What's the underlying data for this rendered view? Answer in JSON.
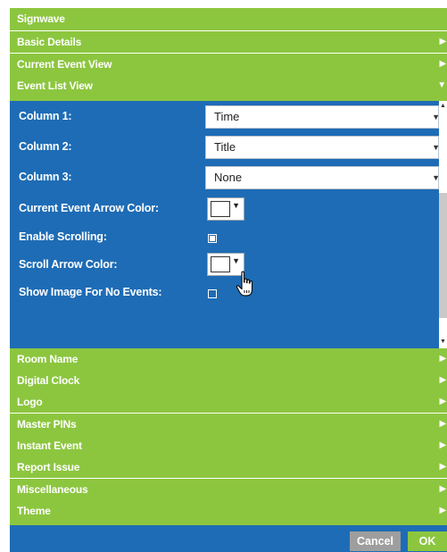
{
  "window": {
    "title": "Signwave"
  },
  "sections_top": [
    {
      "label": "Basic Details",
      "arrow": "▶"
    },
    {
      "label": "Current Event View",
      "arrow": "▶"
    },
    {
      "label": "Event List View",
      "arrow": "▼"
    }
  ],
  "event_list_view": {
    "column1": {
      "label": "Column 1:",
      "value": "Time"
    },
    "column2": {
      "label": "Column 2:",
      "value": "Title"
    },
    "column3": {
      "label": "Column 3:",
      "value": "None"
    },
    "current_arrow_color": {
      "label": "Current Event Arrow Color:",
      "value": "#ffffff"
    },
    "enable_scrolling": {
      "label": "Enable Scrolling:",
      "checked": true
    },
    "scroll_arrow_color": {
      "label": "Scroll Arrow Color:",
      "value": "#ffffff"
    },
    "show_image_no_events": {
      "label": "Show Image For No Events:",
      "checked": false
    }
  },
  "sections_bottom": [
    {
      "label": "Room Name",
      "arrow": "▶"
    },
    {
      "label": "Digital Clock",
      "arrow": "▶"
    },
    {
      "label": "Logo",
      "arrow": "▶"
    },
    {
      "label": "Master PINs",
      "arrow": "▶"
    },
    {
      "label": "Instant Event",
      "arrow": "▶"
    },
    {
      "label": "Report Issue",
      "arrow": "▶"
    },
    {
      "label": "Miscellaneous",
      "arrow": "▶"
    },
    {
      "label": "Theme",
      "arrow": "▶"
    }
  ],
  "footer": {
    "cancel_label": "Cancel",
    "ok_label": "OK"
  },
  "colors": {
    "green": "#8cc63f",
    "blue": "#1e6cb5",
    "gray": "#9e9e9e"
  },
  "icons": {
    "collapsed": "triangle-right-icon",
    "expanded": "triangle-down-icon",
    "dropdown": "caret-down-icon",
    "cursor": "hand-pointer-icon"
  }
}
